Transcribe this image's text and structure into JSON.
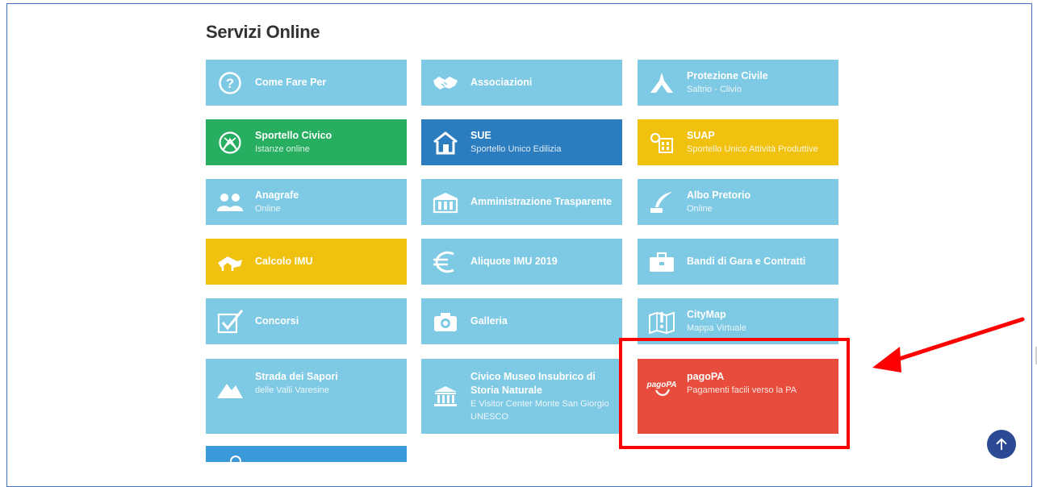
{
  "section": {
    "title": "Servizi Online"
  },
  "colors": {
    "tile_light_blue": "#7ec9e3",
    "tile_green": "#27ae60",
    "tile_dark_blue": "#2b7dc0",
    "tile_yellow": "#f0c20f",
    "tile_red": "#e74c3c",
    "tile_partial_blue": "#3a9ad9",
    "highlight_red": "#ff0000",
    "scroll_button": "#2a4a93"
  },
  "tiles": {
    "come_fare_per": {
      "title": "Come Fare Per",
      "icon": "question-circle-icon"
    },
    "associazioni": {
      "title": "Associazioni",
      "icon": "handshake-icon"
    },
    "protezione_civile": {
      "title": "Protezione Civile",
      "sub": "Saltrio - Clivio",
      "icon": "civil-protection-icon"
    },
    "sportello_civico": {
      "title": "Sportello Civico",
      "sub": "Istanze online",
      "icon": "civic-desk-icon"
    },
    "sue": {
      "title": "SUE",
      "sub": "Sportello Unico Edilizia",
      "icon": "house-icon"
    },
    "suap": {
      "title": "SUAP",
      "sub": "Sportello Unico Attività Produttive",
      "icon": "factory-icon"
    },
    "anagrafe": {
      "title": "Anagrafe",
      "sub": "Online",
      "icon": "people-icon"
    },
    "amministrazione_trasparente": {
      "title": "Amministrazione Trasparente",
      "icon": "building-icon"
    },
    "albo_pretorio": {
      "title": "Albo Pretorio",
      "sub": "Online",
      "icon": "quill-icon"
    },
    "calcolo_imu": {
      "title": "Calcolo IMU",
      "icon": "house-roof-icon"
    },
    "aliquote_imu": {
      "title": "Aliquote IMU 2019",
      "icon": "euro-icon"
    },
    "bandi_gara": {
      "title": "Bandi di Gara e Contratti",
      "icon": "briefcase-icon"
    },
    "concorsi": {
      "title": "Concorsi",
      "icon": "checkbox-icon"
    },
    "galleria": {
      "title": "Galleria",
      "icon": "camera-icon"
    },
    "citymap": {
      "title": "CityMap",
      "sub": "Mappa Virtuale",
      "icon": "map-icon"
    },
    "strada_sapori": {
      "title": "Strada dei Sapori",
      "sub": "delle Valli Varesine",
      "icon": "mountain-icon"
    },
    "civico_museo": {
      "title": "Civico Museo Insubrico di Storia Naturale",
      "sub": "E Visitor Center Monte San Giorgio UNESCO",
      "icon": "museum-icon"
    },
    "pagopa": {
      "title": "pagoPA",
      "sub": "Pagamenti facili verso la PA",
      "icon": "pagopa-logo-icon",
      "logo_text": "pagoPA"
    }
  },
  "scroll_top": {
    "icon": "arrow-up-icon"
  }
}
